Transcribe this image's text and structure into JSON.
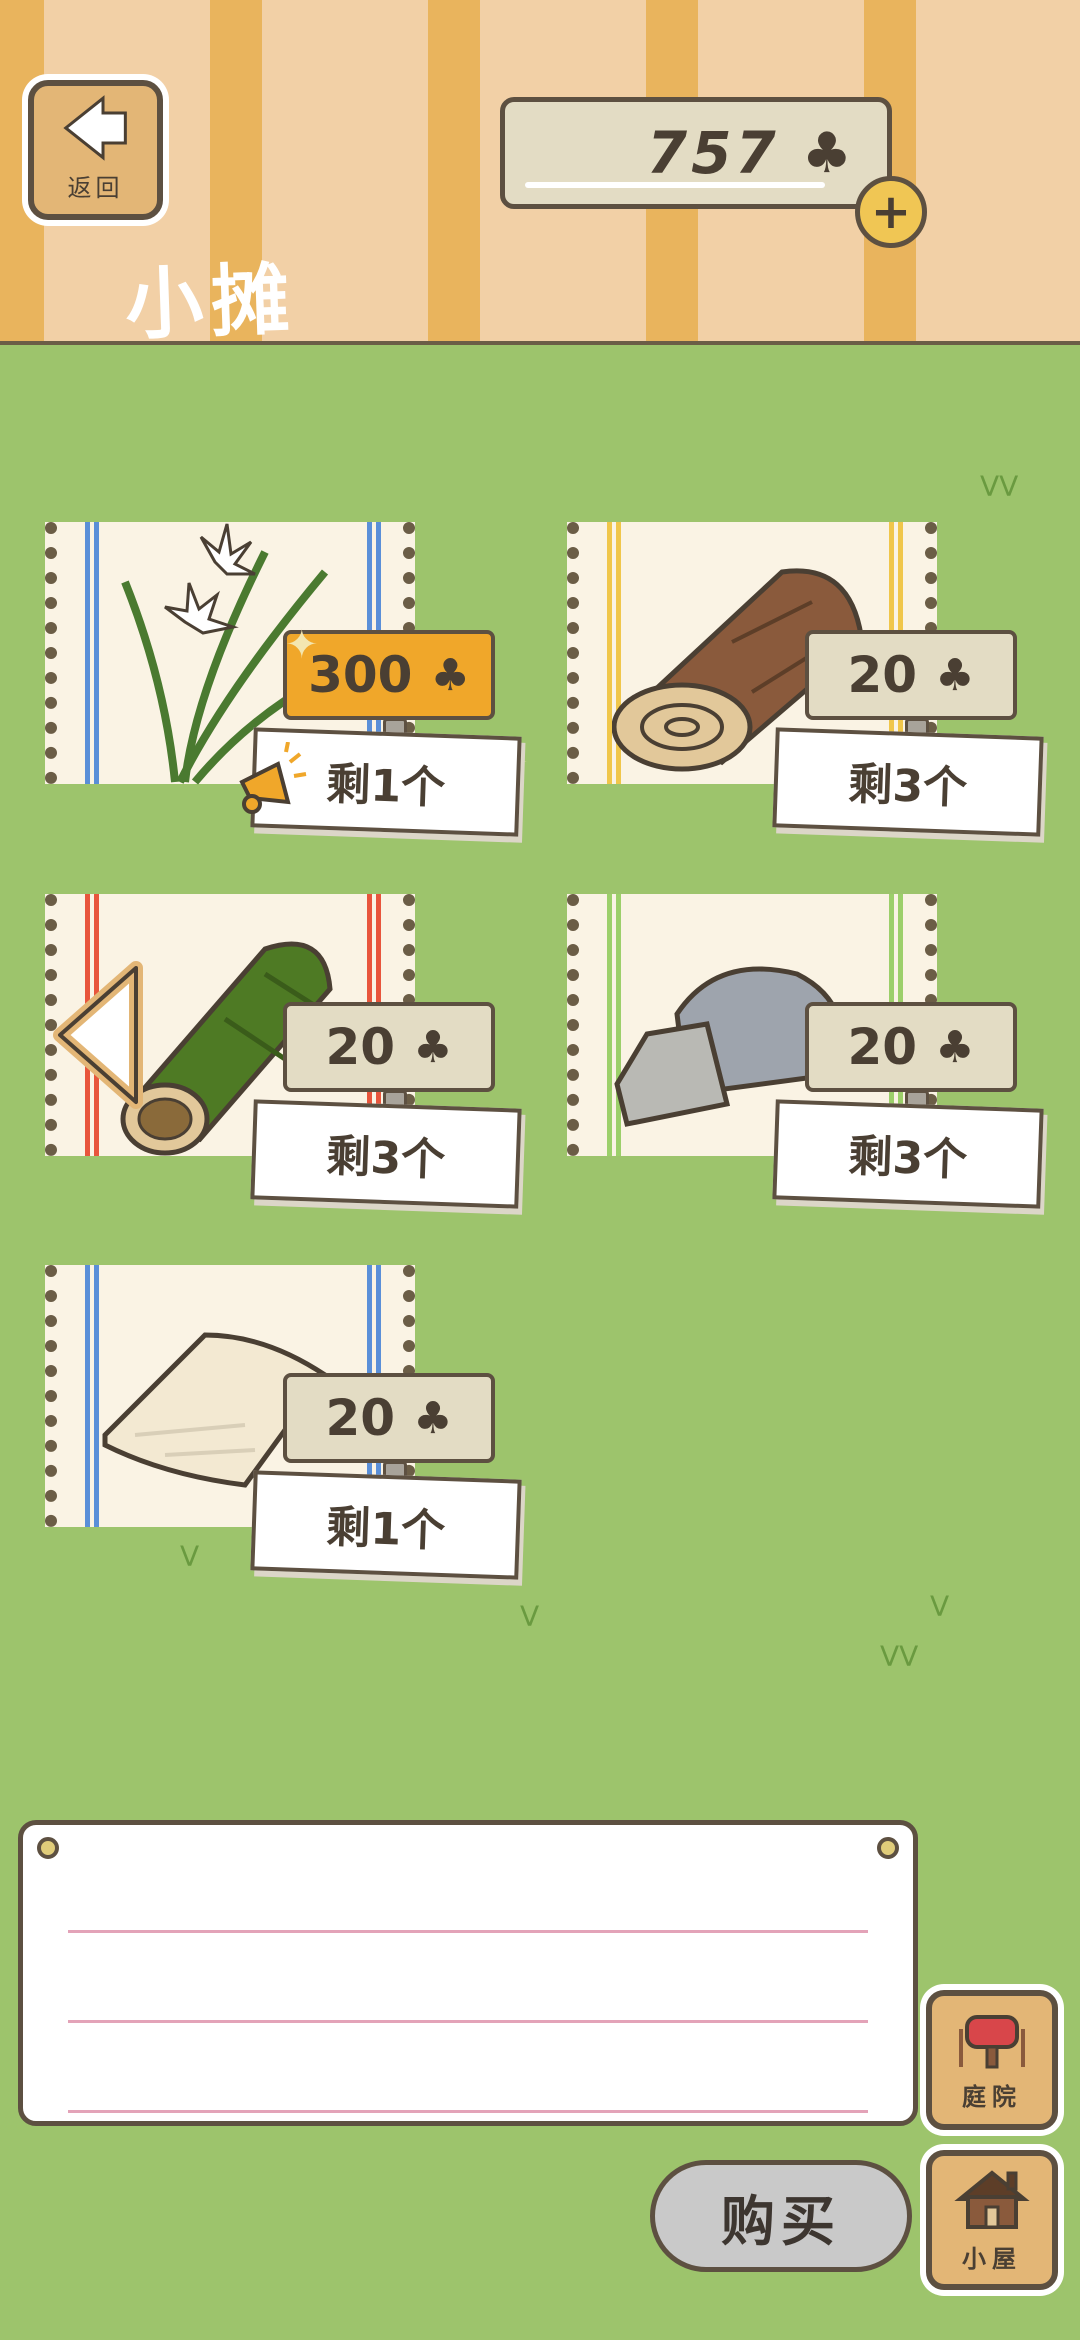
{
  "header": {
    "back_label": "返回",
    "back_icon": "arrow-left-icon",
    "title": "小摊",
    "currency_value": "757",
    "currency_icon": "clover-icon"
  },
  "items": [
    {
      "name": "白色花朵",
      "price": "300",
      "stock": "剩1个",
      "highlight": true
    },
    {
      "name": "木头",
      "price": "20",
      "stock": "剩3个"
    },
    {
      "name": "竹子",
      "price": "20",
      "stock": "剩3个"
    },
    {
      "name": "石头",
      "price": "20",
      "stock": "剩3个"
    },
    {
      "name": "布",
      "price": "20",
      "stock": "剩1个"
    }
  ],
  "buttons": {
    "yard_label": "庭院",
    "house_label": "小屋",
    "buy_label": "购买"
  },
  "colors": {
    "grass": "#9dc46c",
    "header_stripe_dark": "#e9b45d",
    "header_stripe_light": "#f2d0a6",
    "price_highlight": "#f0a72a",
    "price_normal": "#e3dcc4",
    "outline": "#5d5041"
  }
}
